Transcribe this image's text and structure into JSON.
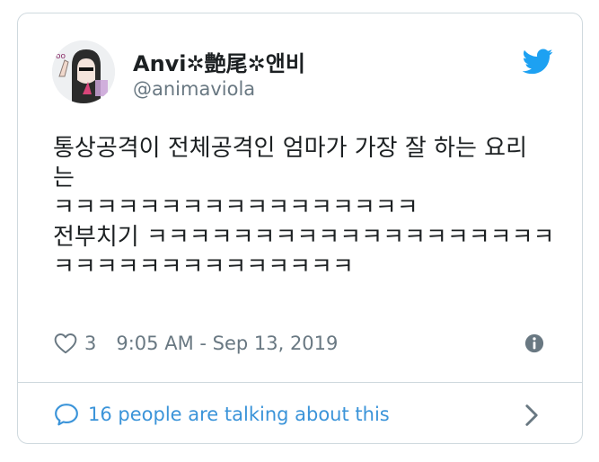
{
  "user": {
    "display_name": "Anvi✲艶尾✲앤비",
    "handle": "@animaviola"
  },
  "tweet": {
    "lines": [
      "통상공격이 전체공격인 엄마가 가장 잘 하는 요리",
      "는",
      "ㅋㅋㅋㅋㅋㅋㅋㅋㅋㅋㅋㅋㅋㅋㅋㅋㅋ",
      "전부치기 ㅋㅋㅋㅋㅋㅋㅋㅋㅋㅋㅋㅋㅋㅋㅋㅋㅋㅋㅋ",
      "ㅋㅋㅋㅋㅋㅋㅋㅋㅋㅋㅋㅋㅋㅋ"
    ]
  },
  "meta": {
    "likes": "3",
    "timestamp": "9:05 AM - Sep 13, 2019"
  },
  "footer": {
    "conversation_text": "16 people are talking about this"
  },
  "colors": {
    "twitter_blue": "#1da1f2",
    "link_blue": "#3b94d9",
    "muted_gray": "#697882",
    "border": "#cfd9de"
  },
  "icons": {
    "brand": "twitter-bird-icon",
    "like": "heart-icon",
    "info": "info-icon",
    "reply": "speech-bubble-icon",
    "more": "chevron-right-icon"
  }
}
